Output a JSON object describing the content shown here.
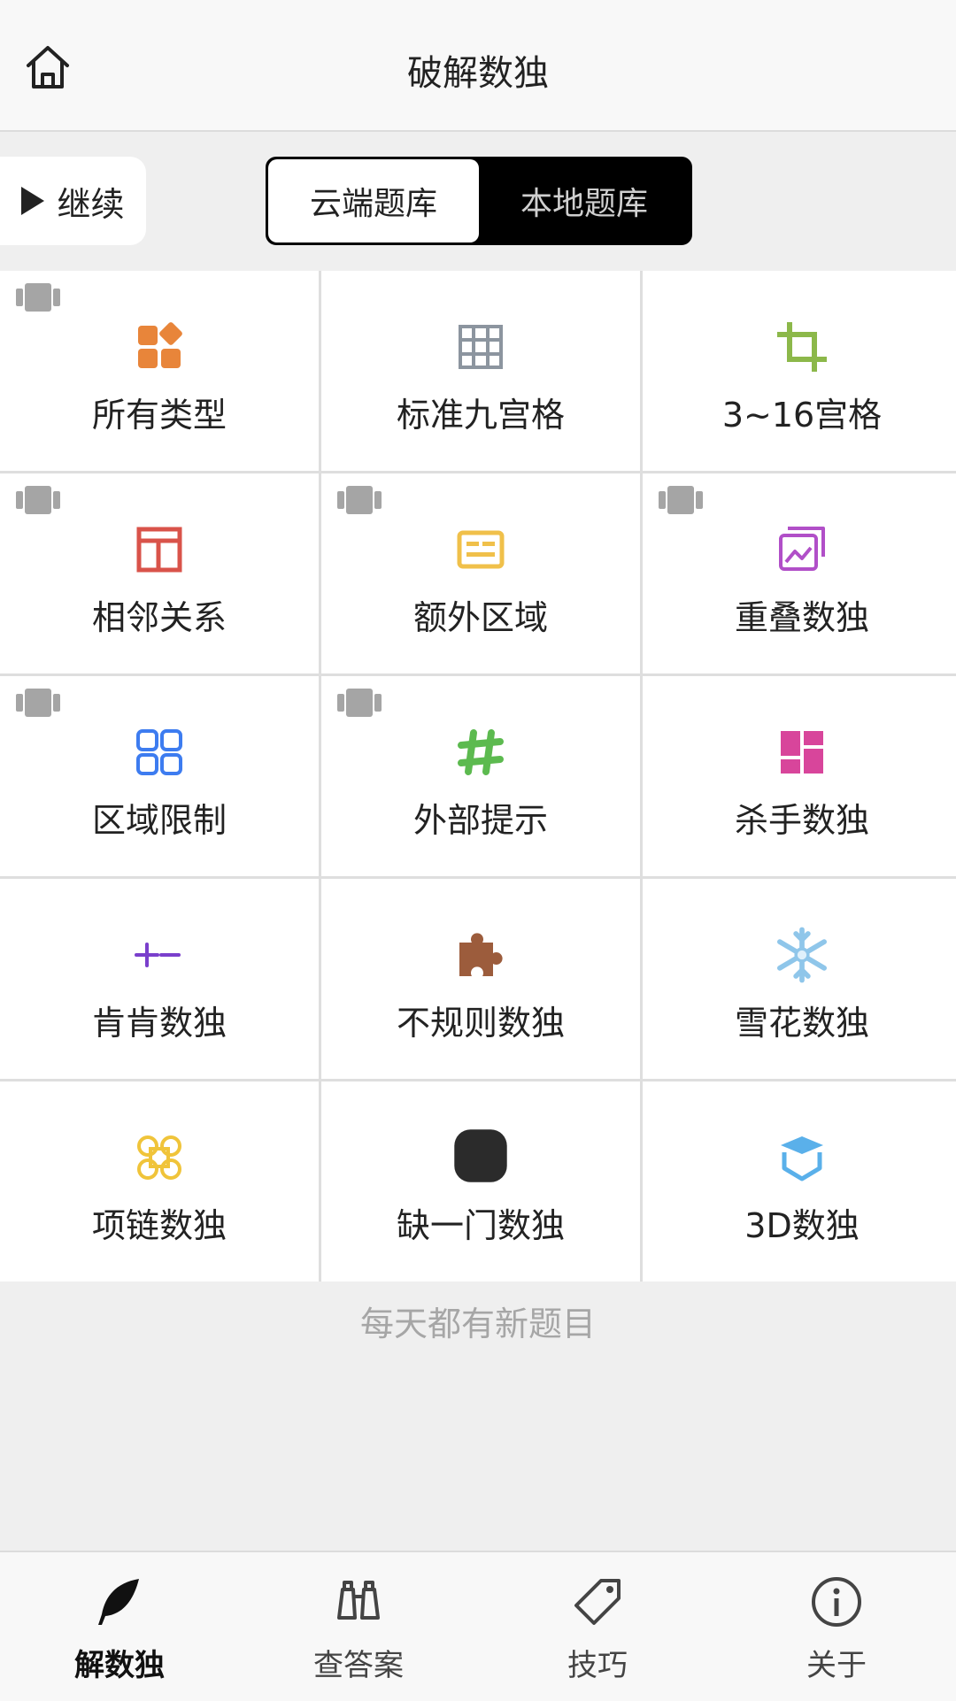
{
  "header": {
    "title": "破解数独",
    "home_icon": "home-icon"
  },
  "toolbar": {
    "continue_label": "继续",
    "source_tabs": [
      {
        "label": "云端题库",
        "selected": true
      },
      {
        "label": "本地题库",
        "selected": false
      }
    ]
  },
  "categories": [
    {
      "label": "所有类型",
      "icon": "four-shapes-icon",
      "color": "#e8853a",
      "tagged": true
    },
    {
      "label": "标准九宫格",
      "icon": "grid-icon",
      "color": "#8c959f",
      "tagged": false
    },
    {
      "label": "3~16宫格",
      "icon": "crop-icon",
      "color": "#8cb84a",
      "tagged": false
    },
    {
      "label": "相邻关系",
      "icon": "layout-icon",
      "color": "#d9534a",
      "tagged": true
    },
    {
      "label": "额外区域",
      "icon": "card-icon",
      "color": "#f0c04a",
      "tagged": true
    },
    {
      "label": "重叠数独",
      "icon": "stacked-images-icon",
      "color": "#b14fc8",
      "tagged": true
    },
    {
      "label": "区域限制",
      "icon": "four-squares-icon",
      "color": "#3d7cf0",
      "tagged": true
    },
    {
      "label": "外部提示",
      "icon": "hashtag-icon",
      "color": "#5cba4f",
      "tagged": true
    },
    {
      "label": "杀手数独",
      "icon": "dashboard-blocks-icon",
      "color": "#d8459b",
      "tagged": false
    },
    {
      "label": "肯肯数独",
      "icon": "math-operators-icon",
      "color": "#7a3fcc",
      "tagged": false
    },
    {
      "label": "不规则数独",
      "icon": "puzzle-piece-icon",
      "color": "#9c5c3c",
      "tagged": false
    },
    {
      "label": "雪花数独",
      "icon": "snowflake-icon",
      "color": "#8fc6ea",
      "tagged": false
    },
    {
      "label": "项链数独",
      "icon": "necklace-icon",
      "color": "#f0c43a",
      "tagged": false
    },
    {
      "label": "缺一门数独",
      "icon": "rounded-square-icon",
      "color": "#2b2b2b",
      "tagged": false
    },
    {
      "label": "3D数独",
      "icon": "cube-icon",
      "color": "#5ab0ea",
      "tagged": false
    }
  ],
  "footer_note": "每天都有新题目",
  "tabbar": [
    {
      "label": "解数独",
      "icon": "feather-icon",
      "active": true
    },
    {
      "label": "查答案",
      "icon": "binoculars-icon",
      "active": false
    },
    {
      "label": "技巧",
      "icon": "tag-icon",
      "active": false
    },
    {
      "label": "关于",
      "icon": "info-icon",
      "active": false
    }
  ]
}
